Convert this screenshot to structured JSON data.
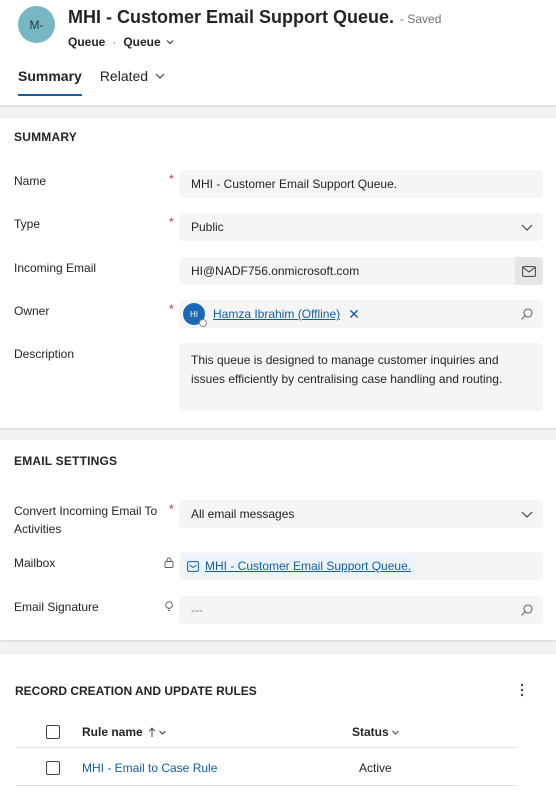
{
  "header": {
    "avatar_initials": "M-",
    "title": "MHI - Customer Email Support Queue.",
    "saved_status": "- Saved",
    "entity": "Queue",
    "separator": "·",
    "form_selector": "Queue"
  },
  "tabs": [
    {
      "label": "Summary",
      "active": true
    },
    {
      "label": "Related",
      "active": false
    }
  ],
  "summary_section": {
    "title": "SUMMARY",
    "fields": {
      "name": {
        "label": "Name",
        "value": "MHI - Customer Email Support Queue.",
        "required": true
      },
      "type": {
        "label": "Type",
        "value": "Public",
        "required": true
      },
      "incoming_email": {
        "label": "Incoming Email",
        "value": "HI@NADF756.onmicrosoft.com"
      },
      "owner": {
        "label": "Owner",
        "required": true,
        "initials": "HI",
        "value": "Hamza Ibrahim (Offline)"
      },
      "description": {
        "label": "Description",
        "value": "This queue is designed to manage customer inquiries and issues efficiently by centralising case handling and routing."
      }
    }
  },
  "email_settings": {
    "title": "EMAIL SETTINGS",
    "fields": {
      "convert": {
        "label": "Convert Incoming Email To Activities",
        "value": "All email messages",
        "required": true
      },
      "mailbox": {
        "label": "Mailbox",
        "value": "MHI - Customer Email Support Queue."
      },
      "signature": {
        "label": "Email Signature",
        "value": "---"
      }
    }
  },
  "rules": {
    "title": "RECORD CREATION AND UPDATE RULES",
    "columns": {
      "rule_name": "Rule name",
      "status": "Status"
    },
    "rows": [
      {
        "rule_name": "MHI - Email to Case Rule",
        "status": "Active"
      }
    ]
  },
  "required_marker": "*",
  "colors": {
    "accent": "#115ea3",
    "required": "#c4314b",
    "avatar": "#78b6c4",
    "owner_avatar": "#1b69b6"
  }
}
